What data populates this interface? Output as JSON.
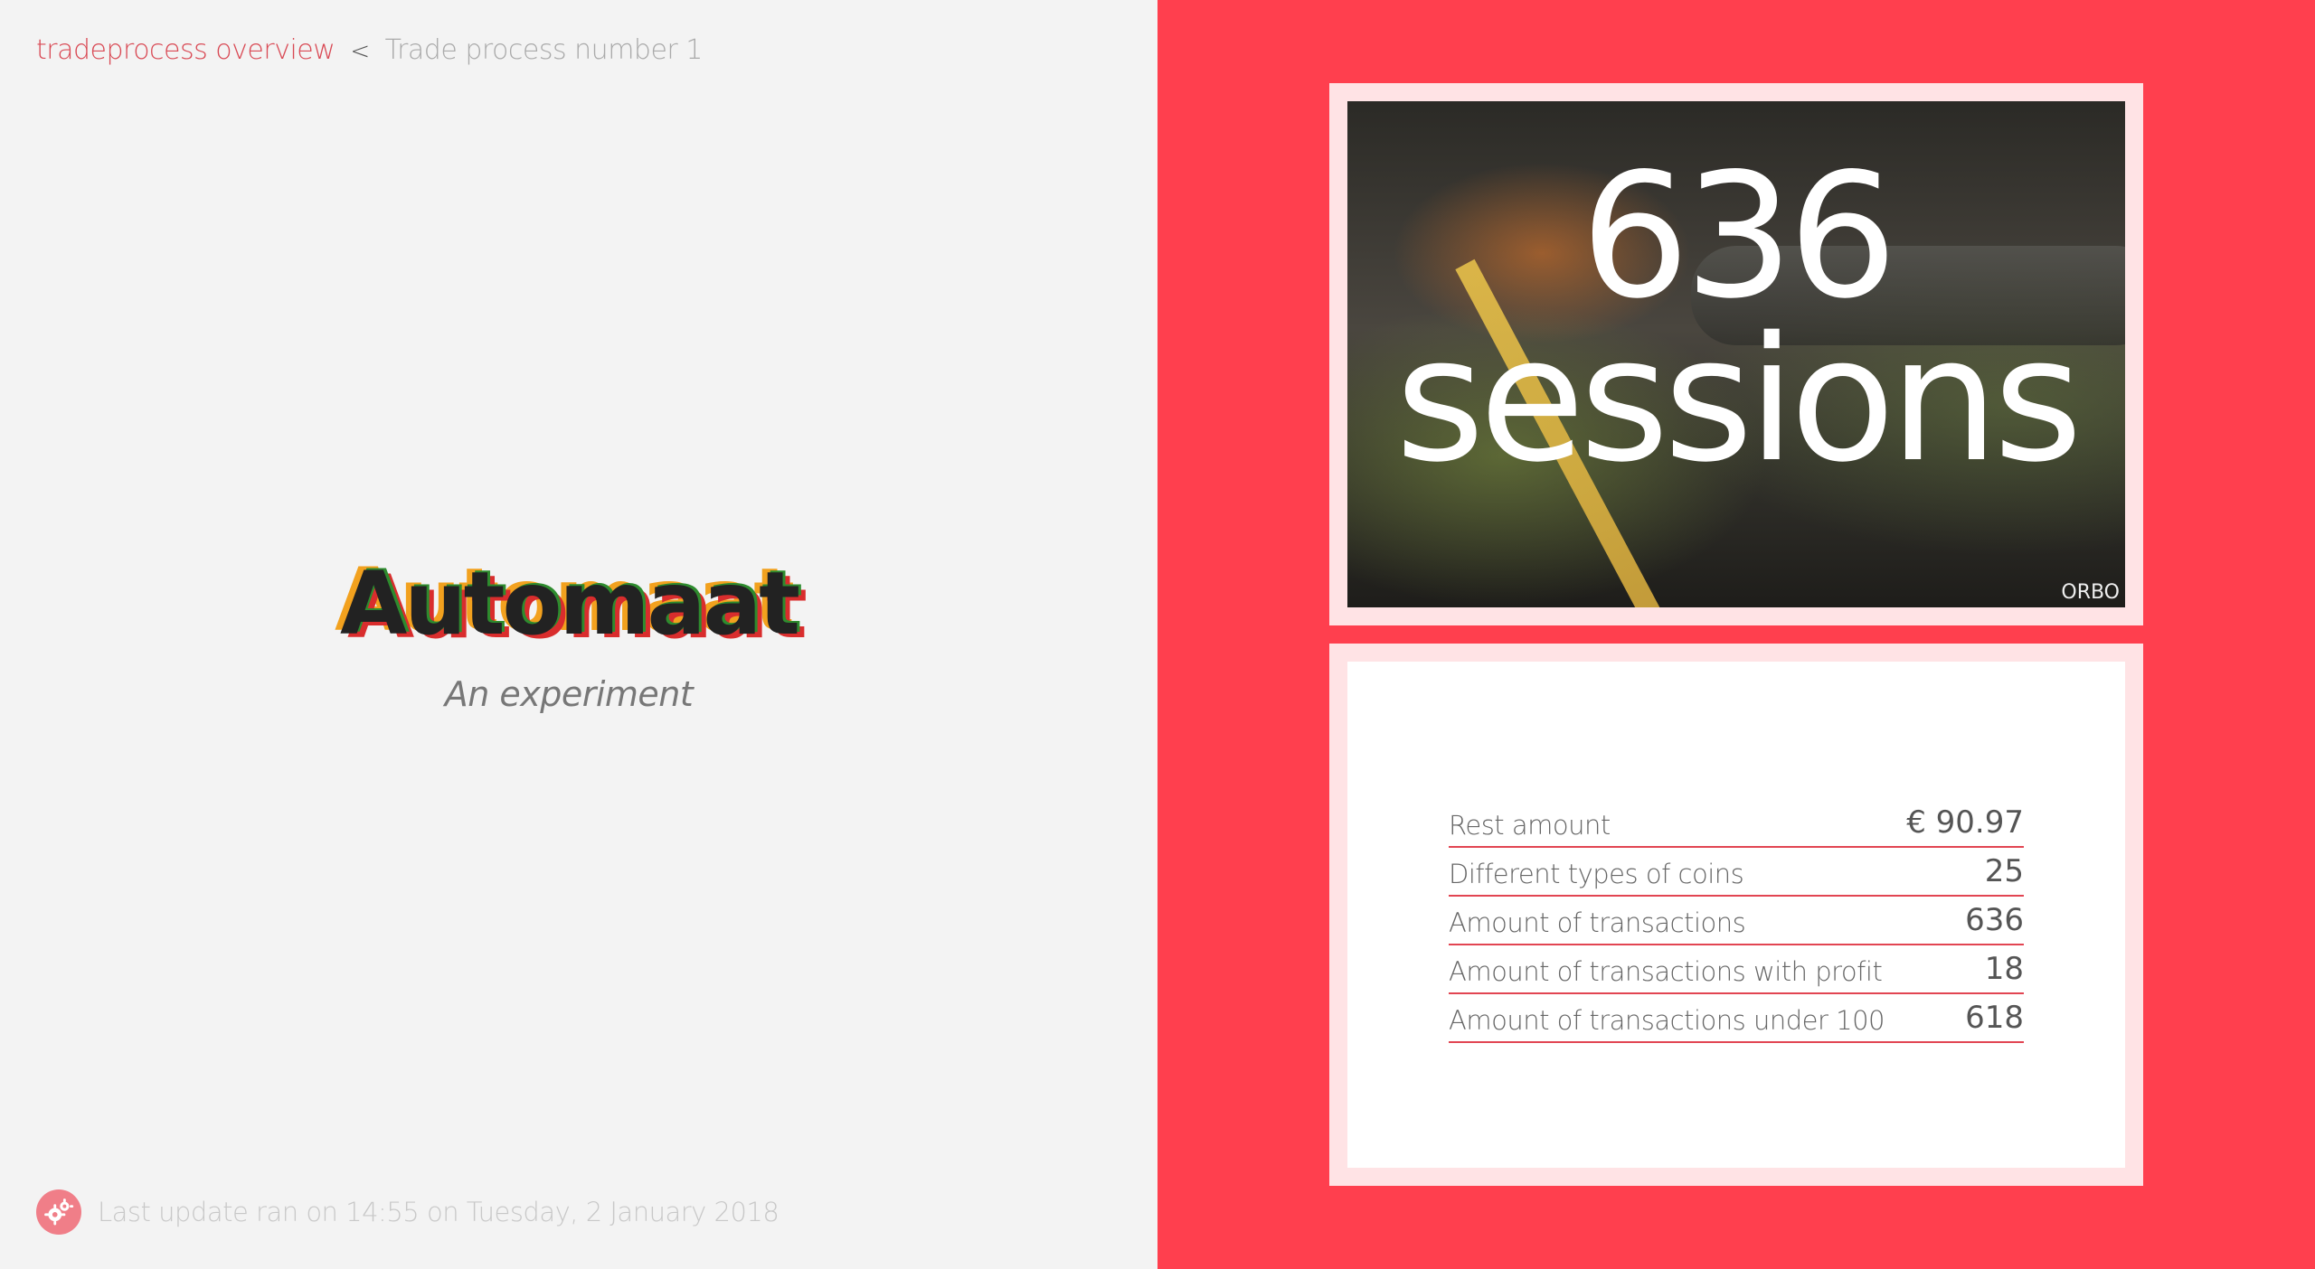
{
  "breadcrumb": {
    "parent": "tradeprocess overview",
    "separator": "<",
    "current": "Trade process number 1"
  },
  "hero": {
    "title": "Automaat",
    "subtitle": "An experiment"
  },
  "footer": {
    "icon": "gear-icon",
    "status": "Last update ran on 14:55 on Tuesday, 2 January 2018"
  },
  "video": {
    "caption_line1": "636",
    "caption_line2": "sessions",
    "watermark": "ORBO"
  },
  "stats": {
    "rows": [
      {
        "label": "Rest amount",
        "value": "€ 90.97"
      },
      {
        "label": "Different types of coins",
        "value": "25"
      },
      {
        "label": "Amount of transactions",
        "value": "636"
      },
      {
        "label": "Amount of transactions with profit",
        "value": "18"
      },
      {
        "label": "Amount of transactions under 100",
        "value": "618"
      }
    ]
  },
  "colors": {
    "accent": "#ff3f4e",
    "link": "#d94a55",
    "card_frame": "#ffe3e5",
    "divider": "#e24552"
  }
}
